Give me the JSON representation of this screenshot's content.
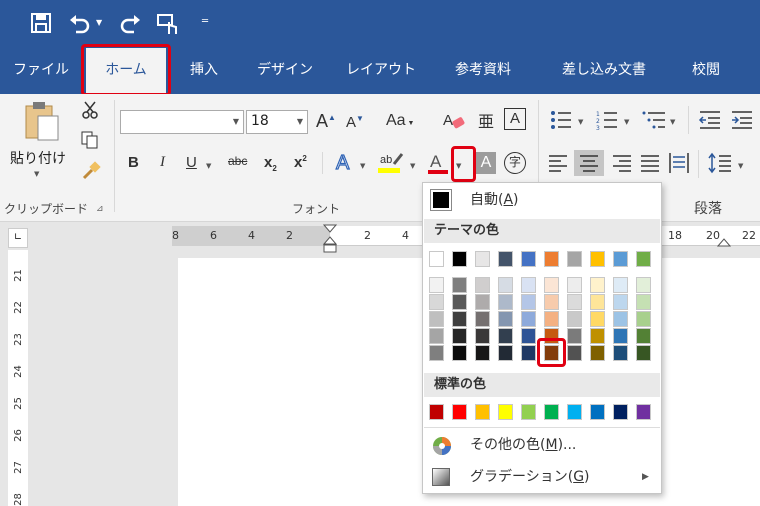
{
  "tabs": [
    "ファイル",
    "ホーム",
    "挿入",
    "デザイン",
    "レイアウト",
    "参考資料",
    "差し込み文書",
    "校閲"
  ],
  "clipboard": {
    "paste_label": "貼り付け",
    "group_label": "クリップボード",
    "launcher": "⊿"
  },
  "font": {
    "name_value": "",
    "size_value": "18",
    "group_label": "フォント",
    "aa": "Aa",
    "abc": "abc",
    "x2": "x",
    "x2sub": "2",
    "x2sup": "2"
  },
  "paragraph": {
    "group_label": "段落"
  },
  "ruler_numbers": [
    "8",
    "6",
    "4",
    "2",
    "2",
    "4",
    "18",
    "20",
    "22"
  ],
  "vruler_numbers": [
    "21",
    "22",
    "23",
    "24",
    "25",
    "26",
    "27",
    "28"
  ],
  "menu": {
    "auto_label": "自動(",
    "auto_key": "A",
    "auto_close": ")",
    "theme_header": "テーマの色",
    "standard_header": "標準の色",
    "more_label": "その他の色(",
    "more_key": "M",
    "more_close": ")...",
    "gradient_label": "グラデーション(",
    "gradient_key": "G",
    "gradient_close": ")"
  },
  "colors": {
    "titlebar": "#2b579a",
    "highlight_red": "#e00012",
    "theme_top": [
      "#ffffff",
      "#000000",
      "#e7e6e6",
      "#44546a",
      "#4472c4",
      "#ed7d31",
      "#a5a5a5",
      "#ffc000",
      "#5b9bd5",
      "#70ad47"
    ],
    "theme_shades": [
      [
        "#f2f2f2",
        "#7f7f7f",
        "#d0cece",
        "#d6dce4",
        "#d9e2f3",
        "#fbe5d5",
        "#ededed",
        "#fff2cc",
        "#deebf6",
        "#e2efd9"
      ],
      [
        "#d8d8d8",
        "#595959",
        "#aeabab",
        "#adb9ca",
        "#b4c6e7",
        "#f7cbac",
        "#dbdbdb",
        "#fee599",
        "#bdd7ee",
        "#c5e0b3"
      ],
      [
        "#bfbfbf",
        "#3f3f3f",
        "#757070",
        "#8496b0",
        "#8eaadb",
        "#f4b183",
        "#c9c9c9",
        "#ffd965",
        "#9cc3e5",
        "#a8d08d"
      ],
      [
        "#a5a5a5",
        "#262626",
        "#3a3838",
        "#323f4f",
        "#2f5496",
        "#c55a11",
        "#7b7b7b",
        "#bf9000",
        "#2e75b5",
        "#538135"
      ],
      [
        "#7f7f7f",
        "#0c0c0c",
        "#171616",
        "#222a35",
        "#1f3864",
        "#833c0b",
        "#525252",
        "#7f6000",
        "#1e4e79",
        "#375623"
      ]
    ],
    "standard": [
      "#c00000",
      "#ff0000",
      "#ffc000",
      "#ffff00",
      "#92d050",
      "#00b050",
      "#00b0f0",
      "#0070c0",
      "#002060",
      "#7030a0"
    ]
  },
  "icons": [
    "save-icon",
    "undo-icon",
    "redo-icon",
    "touch-mode-icon",
    "customize-icon",
    "paste-icon",
    "cut-icon",
    "copy-icon",
    "format-painter-icon",
    "grow-font-icon",
    "shrink-font-icon",
    "clear-format-icon",
    "phonetic-icon",
    "char-border-icon",
    "bold-icon",
    "italic-icon",
    "underline-icon",
    "strikethrough-icon",
    "subscript-icon",
    "superscript-icon",
    "text-effects-icon",
    "highlight-icon",
    "font-color-icon",
    "char-shading-icon",
    "enclose-char-icon",
    "bullets-icon",
    "numbering-icon",
    "multilevel-icon",
    "decrease-indent-icon",
    "increase-indent-icon",
    "align-left-icon",
    "center-icon",
    "align-right-icon",
    "justify-icon",
    "distributed-icon",
    "line-spacing-icon",
    "color-wheel-icon",
    "gradient-icon"
  ]
}
